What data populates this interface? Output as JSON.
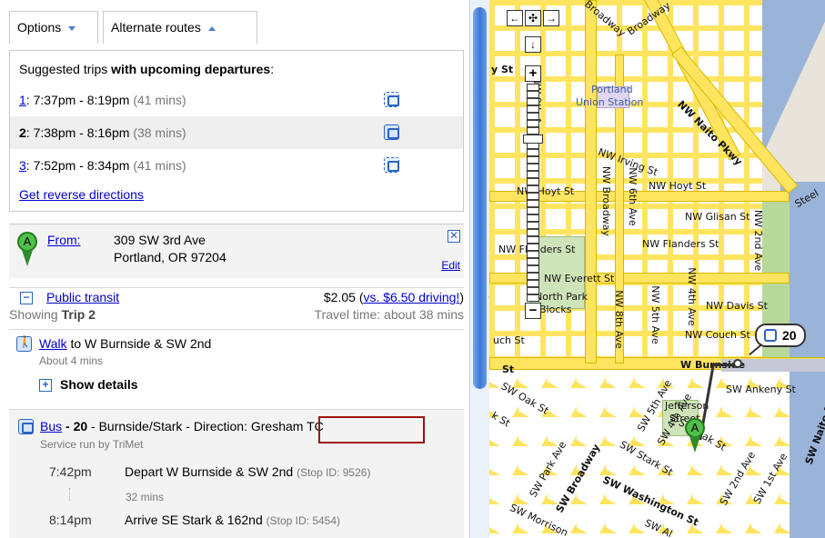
{
  "tabs": {
    "options": "Options",
    "alternate_routes": "Alternate routes"
  },
  "trips": {
    "heading_prefix": "Suggested trips ",
    "heading_bold": "with upcoming departures",
    "heading_suffix": ":",
    "items": [
      {
        "num": "1",
        "time": ": 7:37pm - 8:19pm",
        "duration": "(41 mins)"
      },
      {
        "num": "2",
        "time": ": 7:38pm - 8:16pm",
        "duration": "(38 mins)"
      },
      {
        "num": "3",
        "time": ": 7:52pm - 8:34pm",
        "duration": "(41 mins)"
      }
    ],
    "reverse_link": "Get reverse directions"
  },
  "from": {
    "marker": "A",
    "label": "From:",
    "address_line1": "309 SW 3rd Ave",
    "address_line2": "Portland, OR 97204",
    "edit": "Edit",
    "close": "✕"
  },
  "transit": {
    "toggle": "−",
    "mode": "Public transit",
    "cost": "$2.05 (",
    "compare_link": "vs. $6.50 driving!",
    "cost_close": ")",
    "showing_prefix": "Showing ",
    "showing_bold": "Trip 2",
    "travel_time": "Travel time: about 38 mins"
  },
  "walk": {
    "mode_link": "Walk",
    "destination": " to W Burnside & SW 2nd",
    "duration": "About 4 mins",
    "expand": "+",
    "show_details": "Show details"
  },
  "bus": {
    "mode_link": "Bus",
    "route": " - 20",
    "name": " - Burnside/Stark - Direction: ",
    "direction": "Gresham TC",
    "operator": "Service run by TriMet",
    "depart_time": "7:42pm",
    "depart_text": "Depart W Burnside & SW 2nd",
    "depart_stop": "(Stop ID: 9526)",
    "ride_duration": "32 mins",
    "arrive_time": "8:14pm",
    "arrive_text": "Arrive SE Stark & 162nd",
    "arrive_stop": "(Stop ID: 5454)"
  },
  "map": {
    "labels": {
      "broadway_top": "Broadway",
      "y_st": "y St",
      "portland": "Portland",
      "union_station": "Union Station",
      "naito": "NW Naito Pkwy",
      "nw_9th": "NW 9th Ave",
      "nw_irving": "NW Irving St",
      "nw_hoyt_left": "NW Hoyt St",
      "nw_hoyt_right": "NW Hoyt St",
      "nw_6th": "NW 6th Ave",
      "nw_broadway": "NW Broadway",
      "nw_glisan": "NW Glisan St",
      "nw_flanders_left": "NW Flanders St",
      "nw_flanders_right": "NW Flanders St",
      "nw_2nd": "NW 2nd Ave",
      "nw_everett": "NW Everett St",
      "north_park": "North Park",
      "blocks": "Blocks",
      "nw_4th": "NW 4th Ave",
      "nw_davis": "NW Davis St",
      "nw_5th": "NW 5th Ave",
      "nw_8th": "NW 8th Ave",
      "nw_couch": "NW Couch St",
      "uch_st": "uch St",
      "w_burnside": "W Burnside",
      "st": "St",
      "sw_ankeny": "SW Ankeny St",
      "sw_oak": "SW Oak St",
      "sw_5th": "SW 5th Ave",
      "sw_4th": "SW 4th Ave",
      "sw_park": "SW Park Ave",
      "sw_broadway": "SW Broadway",
      "sw_stark": "SW Stark St",
      "sw_oak_right": "SW Oak St",
      "jefferson": "Jefferson",
      "street": "Street",
      "sw_2nd": "SW 2nd Ave",
      "sw_1st": "SW 1st Ave",
      "sw_naito": "SW Naito Pkwy",
      "sw_washington": "SW Washington St",
      "sw_morrison": "SW Morrison",
      "sw_al": "SW Al",
      "steel": "Steel",
      "k_st": "k St"
    },
    "bus_badge": "20",
    "marker": "A",
    "nav": {
      "up": "↑",
      "left": "←",
      "center": "✣",
      "right": "→",
      "down": "↓",
      "zoom_in": "+",
      "zoom_out": "−"
    }
  }
}
